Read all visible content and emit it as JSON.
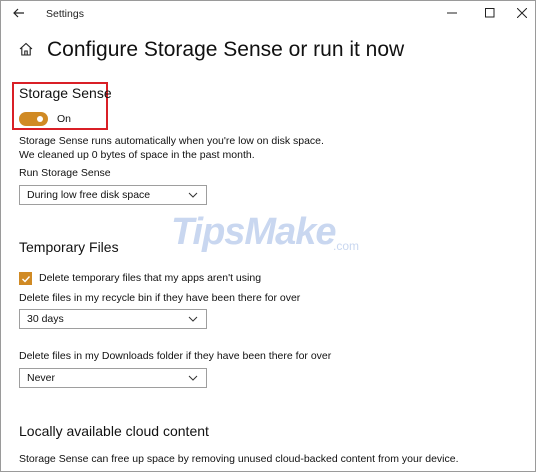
{
  "window": {
    "title": "Settings"
  },
  "page": {
    "title": "Configure Storage Sense or run it now"
  },
  "storage_sense": {
    "heading": "Storage Sense",
    "toggle_label": "On",
    "desc_line1": "Storage Sense runs automatically when you're low on disk space.",
    "desc_line2": "We cleaned up 0 bytes of space in the past month.",
    "run_label": "Run Storage Sense",
    "run_value": "During low free disk space"
  },
  "temp_files": {
    "heading": "Temporary Files",
    "checkbox_label": "Delete temporary files that my apps aren't using",
    "recycle_label": "Delete files in my recycle bin if they have been there for over",
    "recycle_value": "30 days",
    "downloads_label": "Delete files in my Downloads folder if they have been there for over",
    "downloads_value": "Never"
  },
  "cloud": {
    "heading": "Locally available cloud content",
    "desc": "Storage Sense can free up space by removing unused cloud-backed content from your device."
  },
  "watermark": {
    "brand": "TipsMake",
    "suffix": ".com"
  },
  "colors": {
    "accent": "#d08a24",
    "highlight": "#d91f26"
  }
}
